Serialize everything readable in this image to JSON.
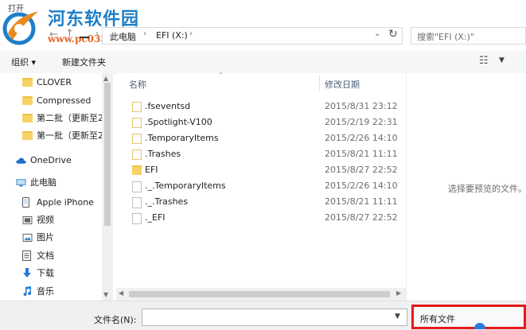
{
  "window": {
    "title": "打开"
  },
  "watermark": {
    "title": "河东软件园",
    "url": "www.pc0359.cn"
  },
  "nav": {
    "back_icon": "arrow-left-icon",
    "forward_icon": "arrow-right-icon",
    "up_icon": "arrow-up-icon",
    "breadcrumbs": [
      "此电脑",
      "EFI (X:)"
    ],
    "search_placeholder": "搜索\"EFI (X:)\""
  },
  "toolbar": {
    "organize_label": "组织 ▾",
    "new_folder_label": "新建文件夹"
  },
  "sidebar": {
    "items": [
      {
        "label": "CLOVER",
        "icon": "folder-icon"
      },
      {
        "label": "Compressed",
        "icon": "folder-icon"
      },
      {
        "label": "第二批（更新至2",
        "icon": "folder-icon"
      },
      {
        "label": "第一批（更新至2",
        "icon": "folder-icon"
      },
      {
        "label": "OneDrive",
        "icon": "cloud-icon"
      },
      {
        "label": "此电脑",
        "icon": "computer-icon"
      },
      {
        "label": "Apple iPhone",
        "icon": "phone-icon"
      },
      {
        "label": "视频",
        "icon": "video-icon"
      },
      {
        "label": "图片",
        "icon": "picture-icon"
      },
      {
        "label": "文档",
        "icon": "document-icon"
      },
      {
        "label": "下载",
        "icon": "download-icon"
      },
      {
        "label": "音乐",
        "icon": "music-icon"
      }
    ]
  },
  "filelist": {
    "columns": {
      "name": "名称",
      "date": "修改日期"
    },
    "rows": [
      {
        "name": ".fseventsd",
        "date": "2015/8/31 23:12",
        "type": "folder"
      },
      {
        "name": ".Spotlight-V100",
        "date": "2015/2/19 22:31",
        "type": "folder"
      },
      {
        "name": ".TemporaryItems",
        "date": "2015/2/26 14:10",
        "type": "folder"
      },
      {
        "name": ".Trashes",
        "date": "2015/8/21 11:11",
        "type": "folder"
      },
      {
        "name": "EFI",
        "date": "2015/8/27 22:52",
        "type": "folder-filled"
      },
      {
        "name": "._.TemporaryItems",
        "date": "2015/2/26 14:10",
        "type": "file"
      },
      {
        "name": "._.Trashes",
        "date": "2015/8/21 11:11",
        "type": "file"
      },
      {
        "name": "._EFI",
        "date": "2015/8/27 22:52",
        "type": "file"
      }
    ]
  },
  "preview": {
    "message": "选择要预览的文件。"
  },
  "bottom": {
    "filename_label": "文件名(N):",
    "filename_value": "",
    "filetype_value": "所有文件",
    "highlight_color": "#e41a1a"
  }
}
